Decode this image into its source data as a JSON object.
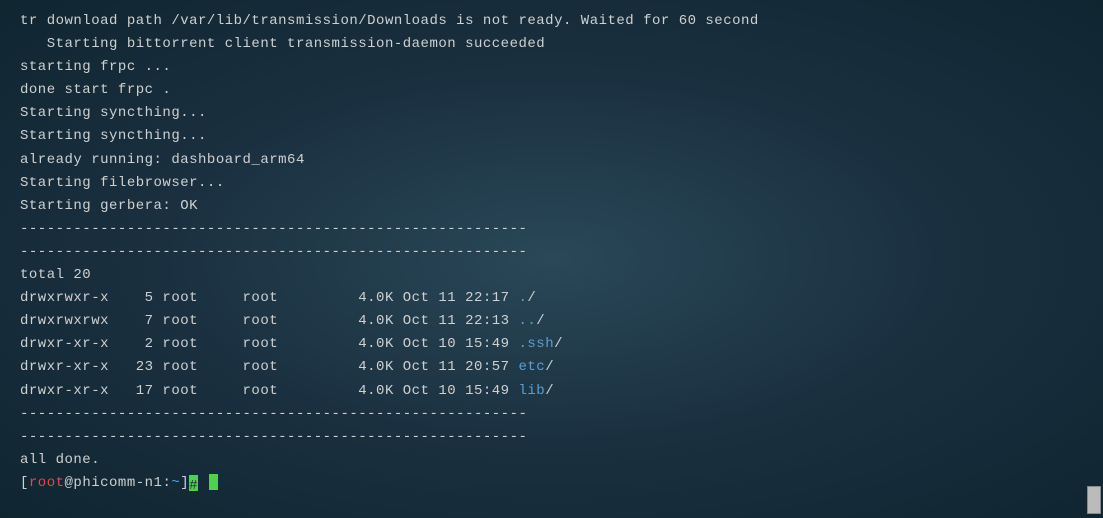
{
  "messages": [
    "tr download path /var/lib/transmission/Downloads is not ready. Waited for 60 second",
    "   Starting bittorrent client transmission-daemon succeeded",
    "starting frpc ...",
    "done start frpc .",
    "Starting syncthing...",
    "Starting syncthing...",
    "already running: dashboard_arm64",
    "Starting filebrowser...",
    "Starting gerbera: OK"
  ],
  "separator": "---------------------------------------------------------",
  "listing": {
    "total": "total 20",
    "rows": [
      {
        "perms": "drwxrwxr-x",
        "links": " 5",
        "owner": "root",
        "group": "root",
        "size": "4.0K",
        "date": "Oct 11 22:17",
        "name": ".",
        "suffix": "/"
      },
      {
        "perms": "drwxrwxrwx",
        "links": " 7",
        "owner": "root",
        "group": "root",
        "size": "4.0K",
        "date": "Oct 11 22:13",
        "name": "..",
        "suffix": "/"
      },
      {
        "perms": "drwxr-xr-x",
        "links": " 2",
        "owner": "root",
        "group": "root",
        "size": "4.0K",
        "date": "Oct 10 15:49",
        "name": ".ssh",
        "suffix": "/"
      },
      {
        "perms": "drwxr-xr-x",
        "links": "23",
        "owner": "root",
        "group": "root",
        "size": "4.0K",
        "date": "Oct 11 20:57",
        "name": "etc",
        "suffix": "/"
      },
      {
        "perms": "drwxr-xr-x",
        "links": "17",
        "owner": "root",
        "group": "root",
        "size": "4.0K",
        "date": "Oct 10 15:49",
        "name": "lib",
        "suffix": "/"
      }
    ]
  },
  "done": "all done.",
  "prompt": {
    "open": "[",
    "user": "root",
    "at": "@",
    "host": "phicomm-n1",
    "colon": ":",
    "path": "~",
    "close": "]",
    "hash": "#"
  }
}
